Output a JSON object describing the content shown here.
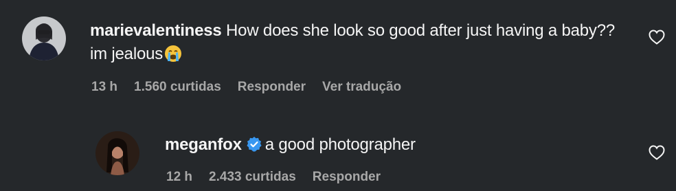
{
  "comments": [
    {
      "username": "marievalentiness",
      "text_line": "How does she look so good after just having a baby?? im jealous",
      "emoji": "crying-face-emoji",
      "time": "13 h",
      "likes": "1.560 curtidas",
      "reply_label": "Responder",
      "translate_label": "Ver tradução"
    },
    {
      "username": "meganfox",
      "verified": true,
      "text": "a good photographer",
      "time": "12 h",
      "likes": "2.433 curtidas",
      "reply_label": "Responder"
    }
  ],
  "icons": {
    "like": "heart-outline-icon",
    "verified": "verified-badge-icon"
  },
  "colors": {
    "background": "#25282b",
    "text": "#f5f5f5",
    "meta": "#a8a8a8",
    "verified": "#3897f0"
  }
}
